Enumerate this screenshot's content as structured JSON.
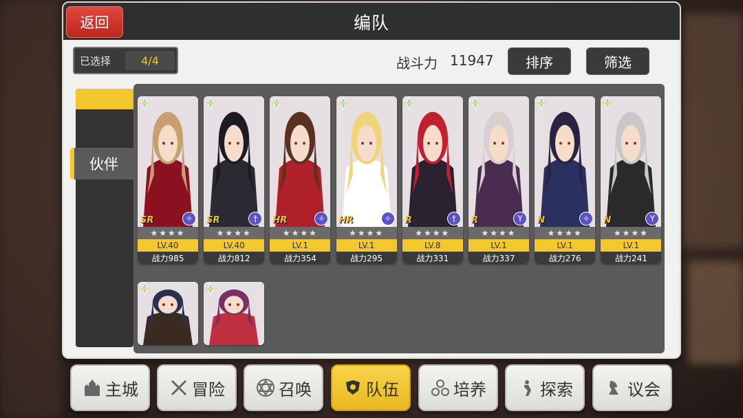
{
  "header": {
    "back_label": "返回",
    "title": "编队"
  },
  "team": {
    "selected_label": "已选择",
    "selected_value": "4/4",
    "power_label": "战斗力",
    "power_value": "11947",
    "sort_label": "排序",
    "filter_label": "筛选"
  },
  "side_tab": {
    "label": "伙伴"
  },
  "characters": [
    {
      "rarity": "SR",
      "stars": "★★★★",
      "level": "LV.40",
      "power": "战力985",
      "class_icon": "magic-icon",
      "hair": "#c8a070",
      "outfit": "#8b1020"
    },
    {
      "rarity": "SR",
      "stars": "★★★★",
      "level": "LV.40",
      "power": "战力812",
      "class_icon": "cross-icon",
      "hair": "#1e1a24",
      "outfit": "#2b2a33"
    },
    {
      "rarity": "HR",
      "stars": "★★★★",
      "level": "LV.1",
      "power": "战力354",
      "class_icon": "magic-icon",
      "hair": "#5a3020",
      "outfit": "#b0202a"
    },
    {
      "rarity": "HR",
      "stars": "★★★★",
      "level": "LV.1",
      "power": "战力295",
      "class_icon": "magic-icon",
      "hair": "#f0d47a",
      "outfit": "#ffffff"
    },
    {
      "rarity": "R",
      "stars": "★★★★",
      "level": "LV.8",
      "power": "战力331",
      "class_icon": "cross-icon",
      "hair": "#c02030",
      "outfit": "#2a2230"
    },
    {
      "rarity": "R",
      "stars": "★★★★",
      "level": "LV.1",
      "power": "战力337",
      "class_icon": "bow-icon",
      "hair": "#d8d0d0",
      "outfit": "#4a2c50"
    },
    {
      "rarity": "N",
      "stars": "★★★★",
      "level": "LV.1",
      "power": "战力276",
      "class_icon": "magic-icon",
      "hair": "#2a2440",
      "outfit": "#2a3060"
    },
    {
      "rarity": "N",
      "stars": "★★★★",
      "level": "LV.1",
      "power": "战力241",
      "class_icon": "bow-icon",
      "hair": "#c8c8c8",
      "outfit": "#2a2a2a"
    }
  ],
  "extra_characters": [
    {
      "hair": "#2a3050",
      "outfit": "#3a2a20"
    },
    {
      "hair": "#7a3060",
      "outfit": "#c03040"
    }
  ],
  "bottom_nav": [
    {
      "label": "主城",
      "icon": "castle-icon"
    },
    {
      "label": "冒险",
      "icon": "swords-icon"
    },
    {
      "label": "召唤",
      "icon": "hexagram-icon"
    },
    {
      "label": "队伍",
      "icon": "team-icon",
      "active": true
    },
    {
      "label": "培养",
      "icon": "triangle-circles-icon"
    },
    {
      "label": "探索",
      "icon": "explore-icon"
    },
    {
      "label": "议会",
      "icon": "council-icon"
    }
  ],
  "colors": {
    "accent_yellow": "#f3c72e",
    "back_red": "#d2372d",
    "dark": "#2f2f2f"
  }
}
